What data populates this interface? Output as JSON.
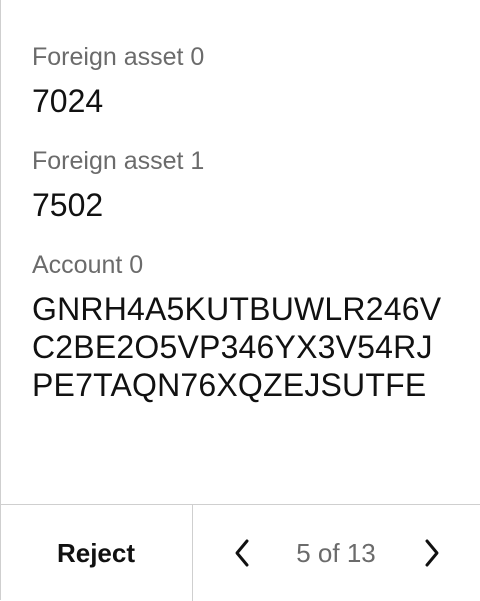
{
  "fields": [
    {
      "label": "Foreign asset 0",
      "value": "7024"
    },
    {
      "label": "Foreign asset 1",
      "value": "7502"
    },
    {
      "label": "Account 0",
      "value": "GNRH4A5KUTBUWLR246VC2BE2O5VP346YX3V54RJPE7TAQN76XQZEJSUTFE"
    }
  ],
  "footer": {
    "reject_label": "Reject",
    "pagination": {
      "current": 5,
      "total": 13,
      "text": "5 of 13"
    },
    "prev_icon": "chevron-left-icon",
    "next_icon": "chevron-right-icon"
  }
}
